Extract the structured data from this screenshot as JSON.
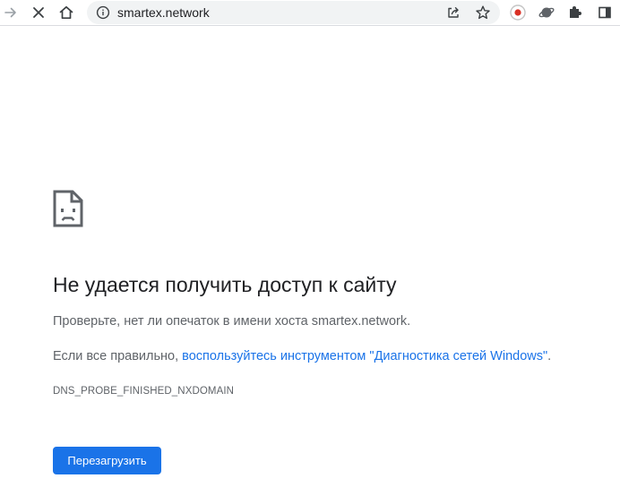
{
  "toolbar": {
    "back_icon": "arrow-right-icon",
    "stop_icon": "close-icon",
    "home_icon": "home-icon",
    "url": "smartex.network",
    "site_info_icon": "info-icon",
    "share_icon": "share-icon",
    "bookmark_icon": "star-icon",
    "extensions": [
      "record-extension-icon",
      "planet-extension-icon",
      "puzzle-icon"
    ],
    "sidepanel_icon": "side-panel-icon"
  },
  "error_page": {
    "icon": "sad-page-icon",
    "heading": "Не удается получить доступ к сайту",
    "check_text": "Проверьте, нет ли опечаток в имени хоста smartex.network.",
    "diag_prefix": "Если все правильно, ",
    "diag_link": "воспользуйтесь инструментом \"Диагностика сетей Windows\"",
    "diag_suffix": ".",
    "error_code": "DNS_PROBE_FINISHED_NXDOMAIN",
    "reload_label": "Перезагрузить"
  },
  "colors": {
    "accent": "#1a73e8",
    "text": "#202124",
    "secondary_text": "#5f6368",
    "omnibox_bg": "#f1f3f4",
    "record_red": "#d93025"
  }
}
